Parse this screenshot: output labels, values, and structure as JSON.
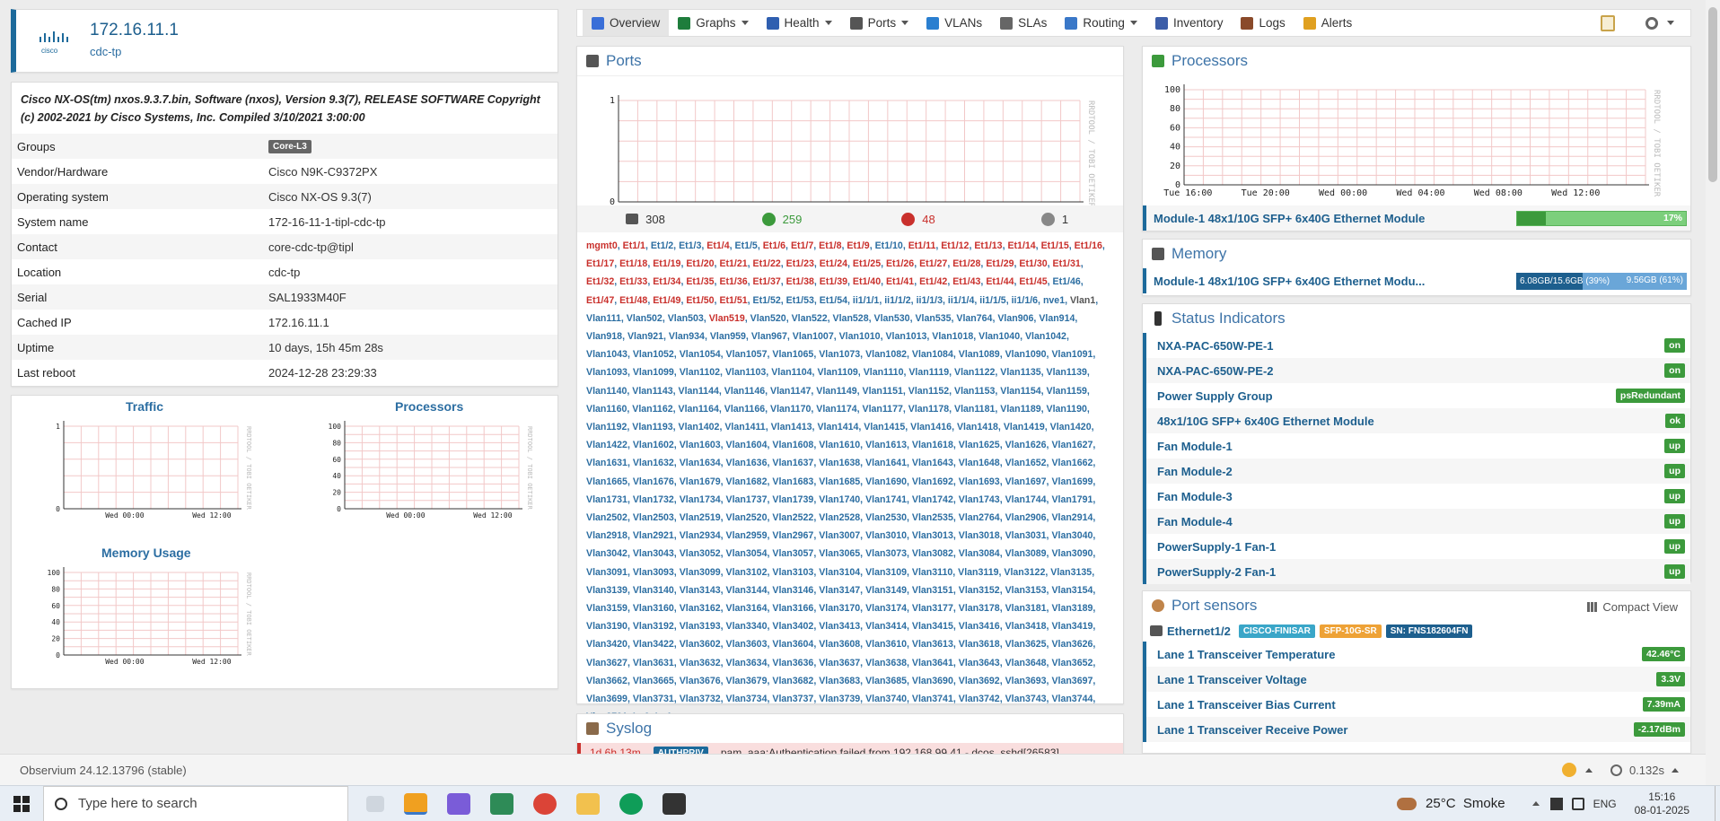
{
  "device": {
    "ip": "172.16.11.1",
    "location_short": "cdc-tp",
    "description": "Cisco NX-OS(tm) nxos.9.3.7.bin, Software (nxos), Version 9.3(7), RELEASE SOFTWARE Copyright (c) 2002-2021 by Cisco Systems, Inc. Compiled 3/10/2021 3:00:00",
    "rows": [
      {
        "k": "Groups",
        "v": "Core-L3",
        "badge": true
      },
      {
        "k": "Vendor/Hardware",
        "v": "Cisco N9K-C9372PX"
      },
      {
        "k": "Operating system",
        "v": "Cisco NX-OS 9.3(7)"
      },
      {
        "k": "System name",
        "v": "172-16-11-1-tipl-cdc-tp"
      },
      {
        "k": "Contact",
        "v": "core-cdc-tp@tipl"
      },
      {
        "k": "Location",
        "v": "cdc-tp"
      },
      {
        "k": "Serial",
        "v": "SAL1933M40F"
      },
      {
        "k": "Cached IP",
        "v": "172.16.11.1"
      },
      {
        "k": "Uptime",
        "v": "10 days, 15h 45m 28s"
      },
      {
        "k": "Last reboot",
        "v": "2024-12-28 23:29:33"
      }
    ]
  },
  "nav": {
    "items": [
      {
        "label": "Overview",
        "icon": "overview-icon",
        "color": "#3a6fd8",
        "caret": false,
        "active": true
      },
      {
        "label": "Graphs",
        "icon": "graphs-icon",
        "color": "#1e7d3c",
        "caret": true
      },
      {
        "label": "Health",
        "icon": "health-icon",
        "color": "#2f5fb0",
        "caret": true
      },
      {
        "label": "Ports",
        "icon": "ports-icon",
        "color": "#555",
        "caret": true
      },
      {
        "label": "VLANs",
        "icon": "vlans-icon",
        "color": "#2a7fd0",
        "caret": false
      },
      {
        "label": "SLAs",
        "icon": "slas-icon",
        "color": "#666",
        "caret": false
      },
      {
        "label": "Routing",
        "icon": "routing-icon",
        "color": "#3a78c8",
        "caret": true
      },
      {
        "label": "Inventory",
        "icon": "inventory-icon",
        "color": "#3c5da8",
        "caret": false
      },
      {
        "label": "Logs",
        "icon": "logs-icon",
        "color": "#8a4a2a",
        "caret": false
      },
      {
        "label": "Alerts",
        "icon": "alerts-icon",
        "color": "#e0a020",
        "caret": false
      }
    ]
  },
  "mini_graphs": {
    "traffic": {
      "title": "Traffic",
      "yticks": [
        "1",
        "0"
      ],
      "xticks": [
        "Wed 00:00",
        "Wed 12:00"
      ]
    },
    "processors": {
      "title": "Processors",
      "yticks": [
        "100",
        "80",
        "60",
        "40",
        "20",
        "0"
      ],
      "xticks": [
        "Wed 00:00",
        "Wed 12:00"
      ]
    },
    "memory": {
      "title": "Memory Usage",
      "yticks": [
        "100",
        "80",
        "60",
        "40",
        "20",
        "0"
      ],
      "xticks": [
        "Wed 00:00",
        "Wed 12:00"
      ]
    },
    "watermark": "RRDTOOL / TOBI OETIKER"
  },
  "ports": {
    "title": "Ports",
    "graph": {
      "yticks": [
        "1",
        "0"
      ],
      "xticks": [
        "Tue 16:00",
        "Tue 20:00",
        "Wed 00:00",
        "Wed 04:00",
        "Wed 08:00",
        "Wed 12:00"
      ]
    },
    "counts": {
      "total": "308",
      "up": "259",
      "down": "48",
      "disabled": "1"
    },
    "list_colors": {
      "up": "#2c6ea2",
      "down": "#c9302c"
    }
  },
  "syslog": {
    "title": "Syslog",
    "time": "1d 6h 13m",
    "tag": "AUTHPRIV",
    "msg": "pam_aaa:Authentication failed from 192.168.99.41 - dcos_sshd[26583]"
  },
  "processors": {
    "title": "Processors",
    "graph": {
      "yticks": [
        "100",
        "80",
        "60",
        "40",
        "20",
        "0"
      ],
      "xticks": [
        "Tue 16:00",
        "Tue 20:00",
        "Wed 00:00",
        "Wed 04:00",
        "Wed 08:00",
        "Wed 12:00"
      ]
    },
    "module": "Module-1 48x1/10G SFP+ 6x40G Ethernet Module",
    "percent": 17,
    "percent_label": "17%"
  },
  "memory": {
    "title": "Memory",
    "module": "Module-1 48x1/10G SFP+ 6x40G Ethernet Modu...",
    "used_label": "6.08GB/15.6GB (39%)",
    "free_label": "9.56GB (61%)",
    "used_fraction": 0.39
  },
  "status": {
    "title": "Status Indicators",
    "items": [
      {
        "name": "NXA-PAC-650W-PE-1",
        "state": "on"
      },
      {
        "name": "NXA-PAC-650W-PE-2",
        "state": "on"
      },
      {
        "name": "Power Supply Group",
        "state": "psRedundant"
      },
      {
        "name": "48x1/10G SFP+ 6x40G Ethernet Module",
        "state": "ok"
      },
      {
        "name": "Fan Module-1",
        "state": "up"
      },
      {
        "name": "Fan Module-2",
        "state": "up"
      },
      {
        "name": "Fan Module-3",
        "state": "up"
      },
      {
        "name": "Fan Module-4",
        "state": "up"
      },
      {
        "name": "PowerSupply-1 Fan-1",
        "state": "up"
      },
      {
        "name": "PowerSupply-2 Fan-1",
        "state": "up"
      }
    ]
  },
  "sensors": {
    "title": "Port sensors",
    "compact_label": "Compact View",
    "port": "Ethernet1/2",
    "vendor": "CISCO-FINISAR",
    "type": "SFP-10G-SR",
    "sn": "SN: FNS182604FN",
    "items": [
      {
        "name": "Lane 1 Transceiver Temperature",
        "value": "42.46°C"
      },
      {
        "name": "Lane 1 Transceiver Voltage",
        "value": "3.3V"
      },
      {
        "name": "Lane 1 Transceiver Bias Current",
        "value": "7.39mA"
      },
      {
        "name": "Lane 1 Transceiver Receive Power",
        "value": "-2.17dBm"
      }
    ]
  },
  "footer": {
    "version": "Observium 24.12.13796 (stable)",
    "time": "0.132s"
  },
  "taskbar": {
    "search_placeholder": "Type here to search",
    "weather": "25°C  Smoke",
    "lang": "ENG",
    "time": "15:16",
    "date": "08-01-2025"
  }
}
